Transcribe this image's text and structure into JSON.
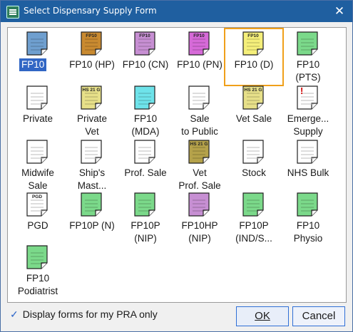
{
  "window": {
    "title": "Select Dispensary Supply Form"
  },
  "forms": [
    {
      "label": "FP10",
      "badge": "",
      "color": "#6f9fcf",
      "selected": true
    },
    {
      "label": "FP10 (HP)",
      "badge": "FP10",
      "color": "#c98a30"
    },
    {
      "label": "FP10 (CN)",
      "badge": "FP10",
      "color": "#c78fd3"
    },
    {
      "label": "FP10 (PN)",
      "badge": "FP10",
      "color": "#d66ad8"
    },
    {
      "label": "FP10 (D)",
      "badge": "FP10",
      "color": "#f5ef7a",
      "highlighted": true
    },
    {
      "label": "FP10 (PTS)",
      "badge": "",
      "color": "#7bd98a"
    },
    {
      "label": "Private",
      "badge": "",
      "color": "#ffffff"
    },
    {
      "label": "Private Vet",
      "badge": "HS 21 G",
      "color": "#e7e089"
    },
    {
      "label": "FP10 (MDA)",
      "badge": "",
      "color": "#6ee3ea"
    },
    {
      "label": "Sale to Public",
      "badge": "",
      "color": "#ffffff"
    },
    {
      "label": "Vet Sale",
      "badge": "HS 21 G",
      "color": "#e7e089"
    },
    {
      "label": "Emerge... Supply",
      "badge": "!",
      "color": "#ffffff"
    },
    {
      "label": "Midwife Sale",
      "badge": "",
      "color": "#ffffff"
    },
    {
      "label": "Ship's Mast...",
      "badge": "",
      "color": "#ffffff"
    },
    {
      "label": "Prof. Sale",
      "badge": "",
      "color": "#ffffff"
    },
    {
      "label": "Vet Prof. Sale",
      "badge": "HS 21 G",
      "color": "#b5a24a"
    },
    {
      "label": "Stock",
      "badge": "",
      "color": "#ffffff"
    },
    {
      "label": "NHS Bulk",
      "badge": "",
      "color": "#ffffff"
    },
    {
      "label": "PGD",
      "badge": "PGD",
      "color": "#ffffff"
    },
    {
      "label": "FP10P (N)",
      "badge": "",
      "color": "#7bd98a"
    },
    {
      "label": "FP10P (NIP)",
      "badge": "",
      "color": "#7bd98a"
    },
    {
      "label": "FP10HP (NIP)",
      "badge": "",
      "color": "#c78fd3"
    },
    {
      "label": "FP10P (IND/S...",
      "badge": "",
      "color": "#7bd98a"
    },
    {
      "label": "FP10 Physio",
      "badge": "",
      "color": "#7bd98a"
    },
    {
      "label": "FP10 Podiatrist",
      "badge": "",
      "color": "#7bd98a"
    }
  ],
  "footer": {
    "checkbox_label": "Display forms for my PRA only",
    "checked": true,
    "ok_label": "OK",
    "cancel_label": "Cancel"
  }
}
